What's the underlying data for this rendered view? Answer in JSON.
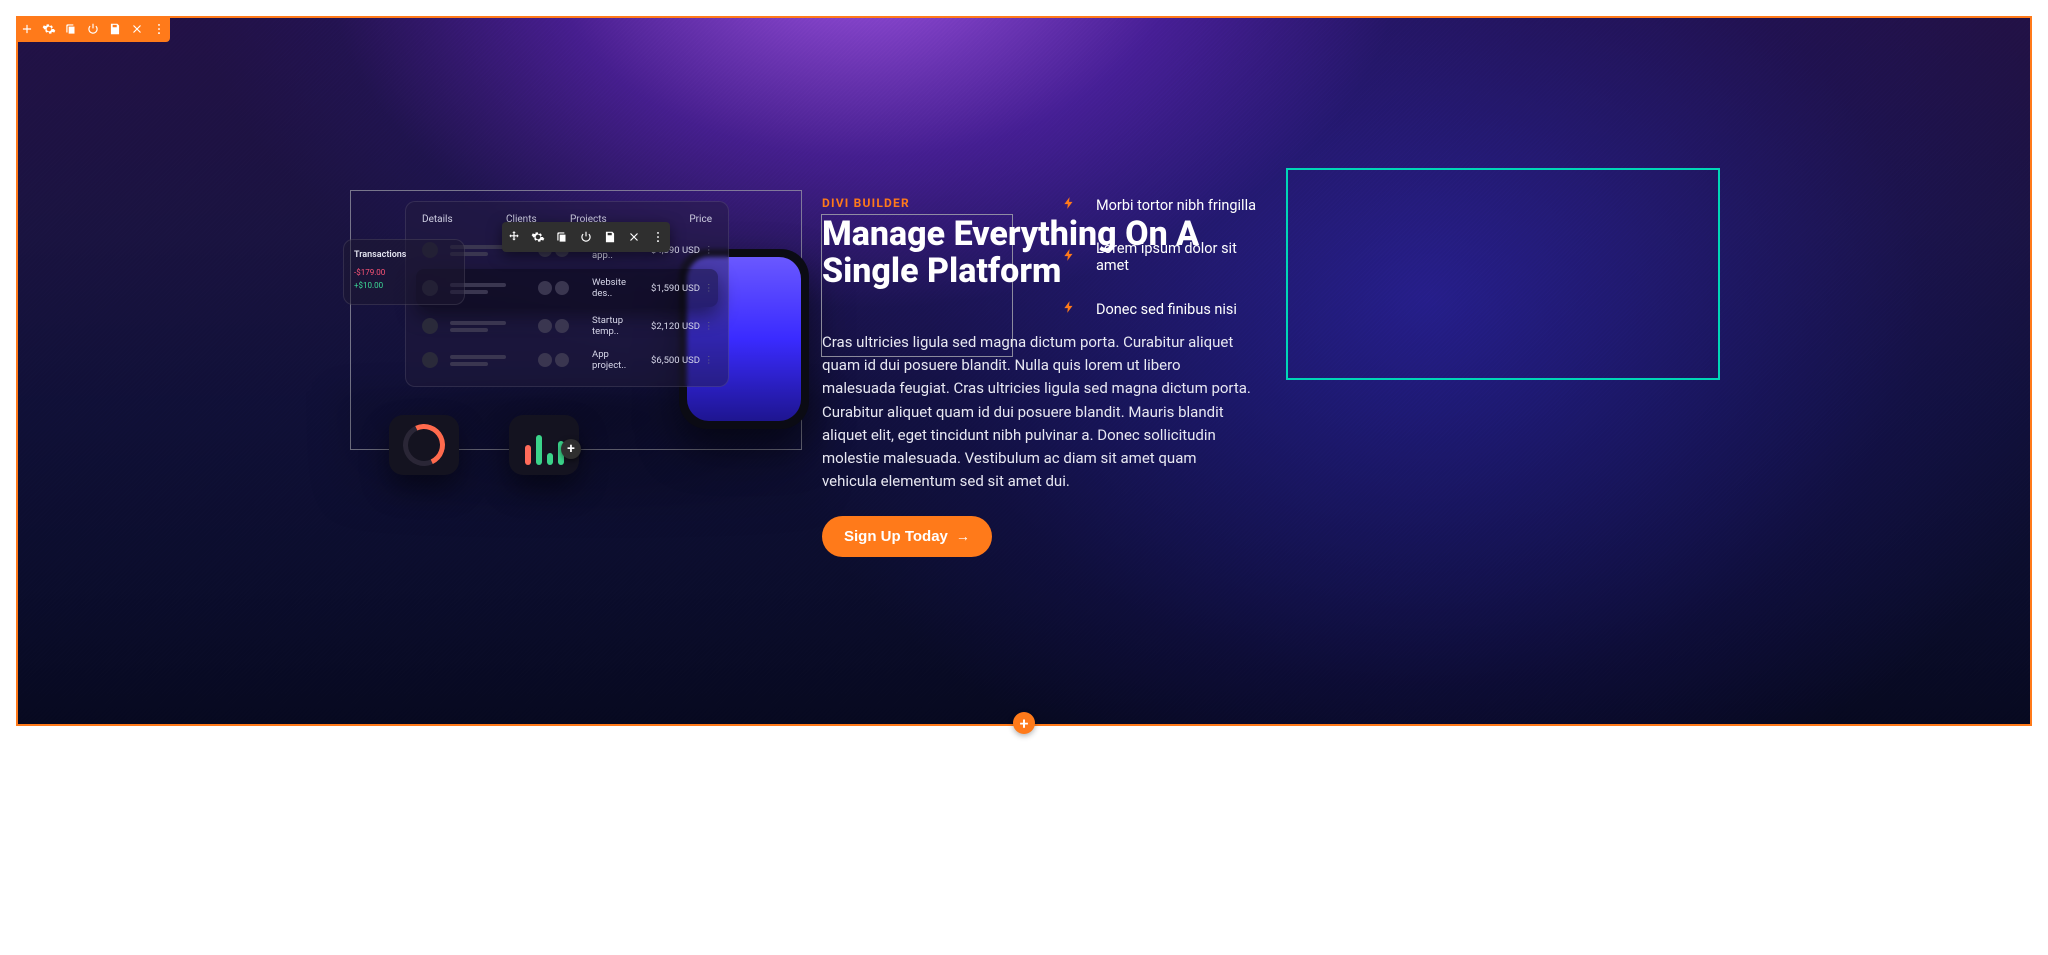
{
  "section_toolbar": {
    "buttons": [
      "add",
      "settings",
      "duplicate",
      "power",
      "save",
      "delete",
      "more"
    ]
  },
  "module_toolbar": {
    "buttons": [
      "move",
      "settings",
      "duplicate",
      "power",
      "save",
      "delete",
      "more"
    ]
  },
  "content": {
    "eyebrow": "DIVI BUILDER",
    "headline": "Manage Everything On A Single Platform",
    "body": "Cras ultricies ligula sed magna dictum porta. Curabitur aliquet quam id dui posuere blandit. Nulla quis lorem ut libero malesuada feugiat. Cras ultricies ligula sed magna dictum porta. Curabitur aliquet quam id dui posuere blandit. Mauris blandit aliquet elit, eget tincidunt nibh pulvinar a. Donec sollicitudin molestie malesuada. Vestibulum ac diam sit amet quam vehicula elementum sed sit amet dui.",
    "cta_label": "Sign Up Today"
  },
  "features": [
    "Morbi tortor nibh fringilla",
    "Lorem ipsum dolor sit amet",
    "Donec sed finibus nisi"
  ],
  "mockup": {
    "tabs": {
      "c1": "Details",
      "c2": "Clients",
      "c3": "Projects",
      "c4": "Price"
    },
    "rows": [
      {
        "name": "Finance app..",
        "price": "$4,390 USD"
      },
      {
        "name": "Website des..",
        "price": "$1,590 USD"
      },
      {
        "name": "Startup temp..",
        "price": "$2,120 USD"
      },
      {
        "name": "App project..",
        "price": "$6,500 USD"
      }
    ],
    "transactions": {
      "title": "Transactions",
      "rows": [
        {
          "amount": "-$179.00",
          "sub": ""
        },
        {
          "amount": "+$10.00",
          "sub": ""
        }
      ]
    }
  },
  "icons": {
    "plus": "+",
    "arrow": "→",
    "bolt": "⚡",
    "dots": "⋮"
  }
}
